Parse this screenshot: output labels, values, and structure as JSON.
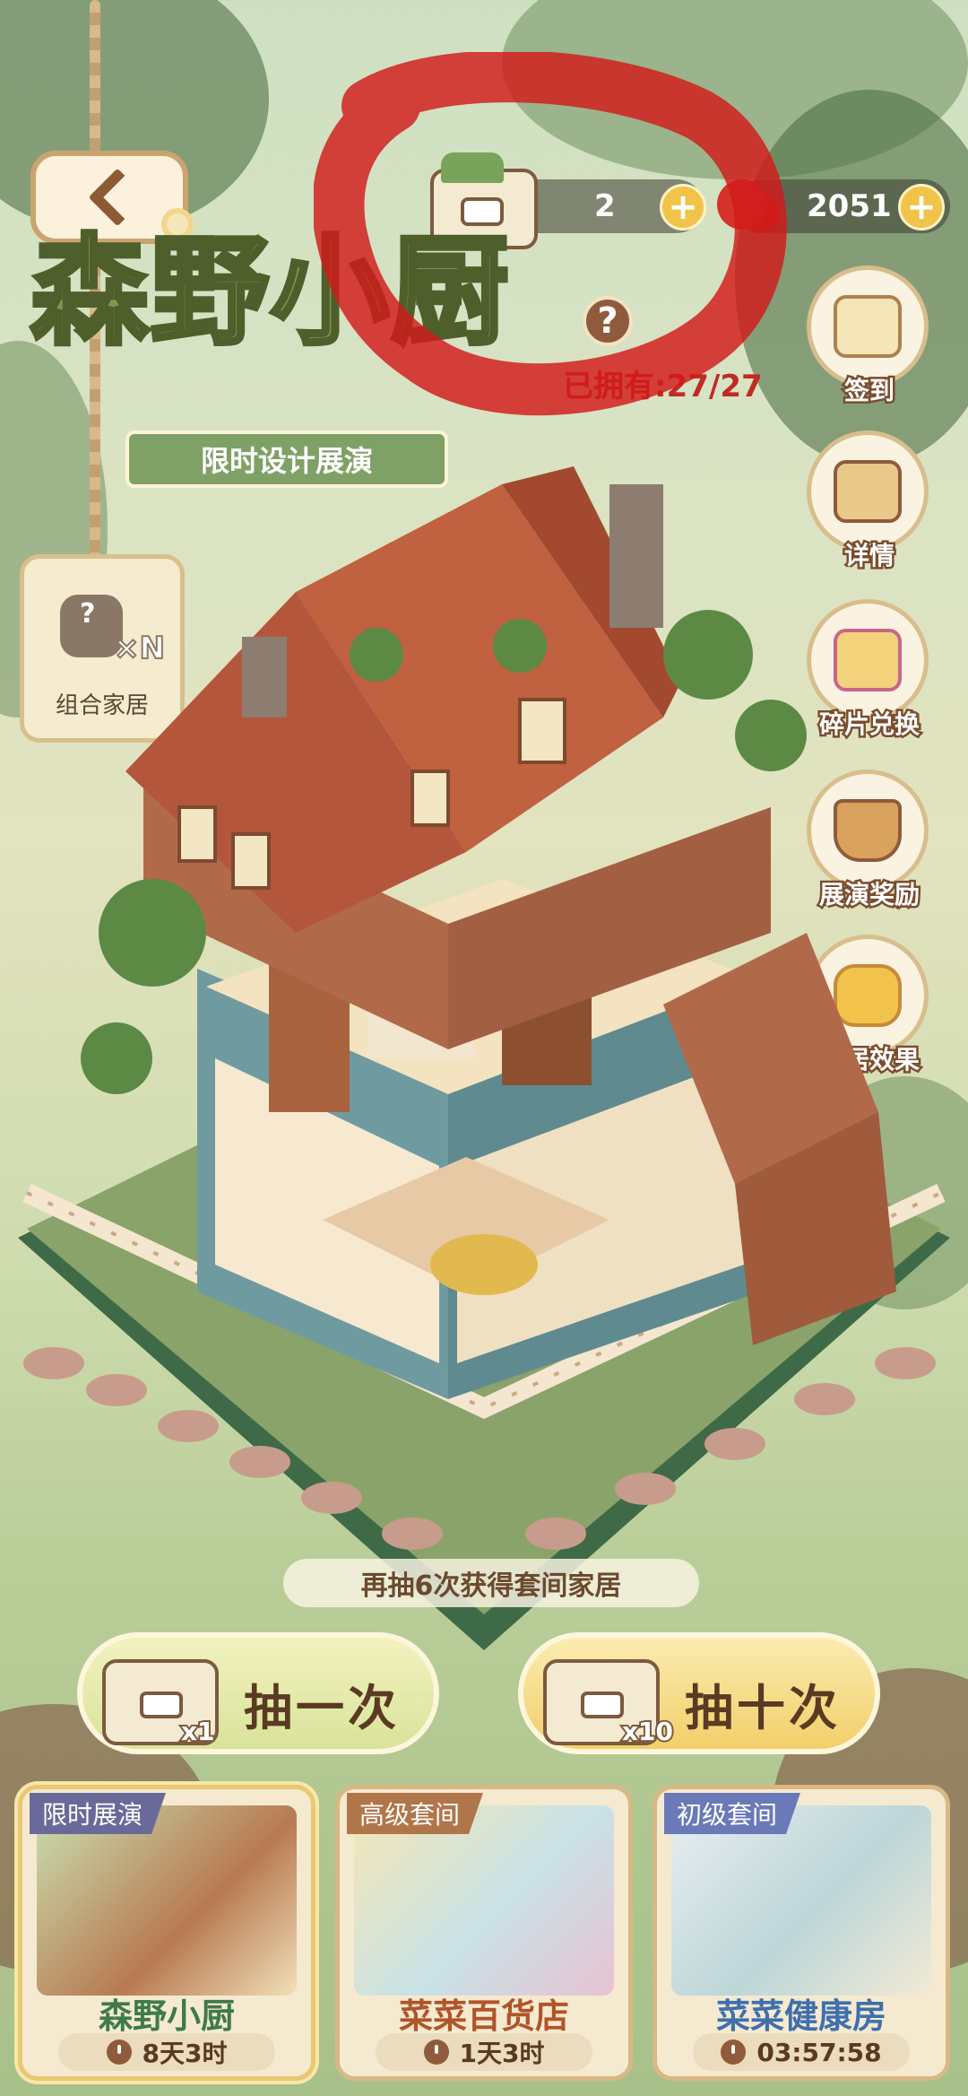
{
  "header": {
    "tickets": "2",
    "currency": "2051",
    "title": "森野小厨",
    "help_label": "?",
    "owned_text": "已拥有:27/27"
  },
  "banner_text": "限时设计展演",
  "combo": {
    "label": "组合家居",
    "count_text": "×N",
    "question": "?"
  },
  "side_buttons": [
    {
      "label": "签到",
      "icon": "calendar-icon"
    },
    {
      "label": "详情",
      "icon": "clipboard-magnifier-icon"
    },
    {
      "label": "碎片兑换",
      "icon": "gift-box-icon"
    },
    {
      "label": "展演奖励",
      "icon": "basket-icon"
    },
    {
      "label": "家居效果",
      "icon": "sofa-icon"
    }
  ],
  "hint": "再抽6次获得套间家居",
  "draw": {
    "one": {
      "label": "抽一次",
      "multiplier": "x1"
    },
    "ten": {
      "label": "抽十次",
      "multiplier": "x10"
    }
  },
  "cards": [
    {
      "tag": "限时展演",
      "name": "森野小厨",
      "timer": "8天3时"
    },
    {
      "tag": "高级套间",
      "name": "菜菜百货店",
      "timer": "1天3时"
    },
    {
      "tag": "初级套间",
      "name": "菜菜健康房",
      "timer": "03:57:58"
    }
  ],
  "colors": {
    "accent_red": "#c22a24",
    "title_green": "#7a9a4e",
    "button_gold": "#f2c34a"
  }
}
